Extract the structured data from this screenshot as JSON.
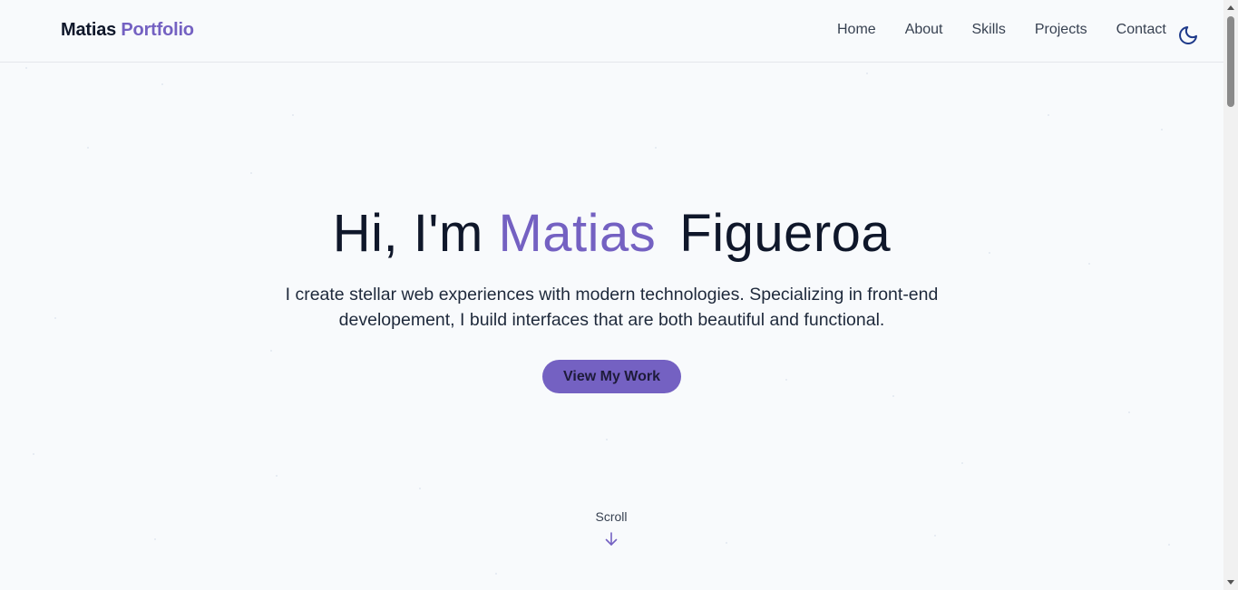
{
  "brand": {
    "name": "Matias",
    "accent": "Portfolio"
  },
  "nav": {
    "items": [
      {
        "label": "Home"
      },
      {
        "label": "About"
      },
      {
        "label": "Skills"
      },
      {
        "label": "Projects"
      },
      {
        "label": "Contact"
      }
    ],
    "theme_toggle_icon": "moon-icon"
  },
  "hero": {
    "greeting": "Hi, I'm",
    "first_name": "Matias",
    "last_name": "Figueroa",
    "description": "I create stellar web experiences with modern technologies. Specializing in front-end developement, I build interfaces that are both beautiful and functional.",
    "cta_label": "View My Work",
    "scroll_label": "Scroll",
    "scroll_icon": "arrow-down-icon"
  },
  "colors": {
    "accent": "#7461c2",
    "background": "#f8fafc",
    "text": "#0f172a"
  }
}
